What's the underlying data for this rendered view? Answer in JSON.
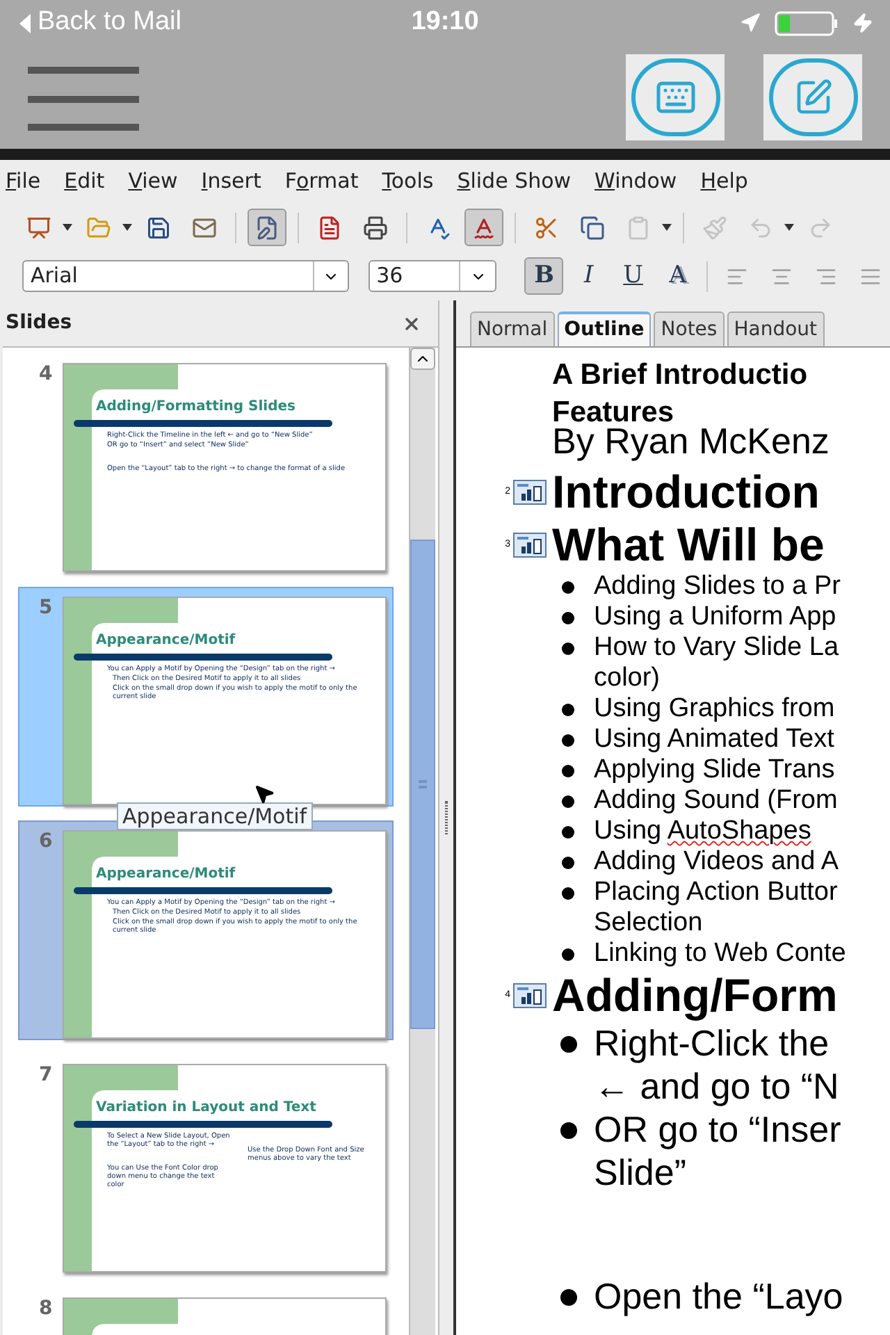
{
  "status_bar": {
    "back_label": "Back to Mail",
    "time": "19:10"
  },
  "menu": [
    {
      "key": "F",
      "after": "ile"
    },
    {
      "key": "E",
      "after": "dit"
    },
    {
      "key": "V",
      "after": "iew"
    },
    {
      "key": "I",
      "after": "nsert"
    },
    {
      "before": "F",
      "key": "o",
      "after": "rmat"
    },
    {
      "key": "T",
      "after": "ools"
    },
    {
      "key": "S",
      "after": "lide Show"
    },
    {
      "key": "W",
      "after": "indow"
    },
    {
      "key": "H",
      "after": "elp"
    }
  ],
  "standard_toolbar": [
    {
      "pressed": false,
      "disabled": false,
      "dropdown": true
    },
    {
      "pressed": false,
      "disabled": false,
      "dropdown": true
    },
    {
      "pressed": false,
      "disabled": false,
      "dropdown": false
    },
    {
      "pressed": false,
      "disabled": false,
      "dropdown": false
    },
    {
      "pressed": true,
      "disabled": false,
      "dropdown": false
    },
    {
      "pressed": false,
      "disabled": false,
      "dropdown": false
    },
    {
      "pressed": false,
      "disabled": false,
      "dropdown": false
    },
    {
      "pressed": false,
      "disabled": false,
      "dropdown": false
    },
    {
      "pressed": true,
      "disabled": false,
      "dropdown": false
    },
    {
      "pressed": false,
      "disabled": false,
      "dropdown": false
    },
    {
      "pressed": false,
      "disabled": false,
      "dropdown": false
    },
    {
      "pressed": false,
      "disabled": true,
      "dropdown": true
    },
    {
      "pressed": false,
      "disabled": true,
      "dropdown": false
    },
    {
      "pressed": false,
      "disabled": true,
      "dropdown": true
    },
    {
      "pressed": false,
      "disabled": true,
      "dropdown": false
    }
  ],
  "format_toolbar": {
    "font_name": "Arial",
    "font_size": "36",
    "style_buttons": [
      {
        "label": "B",
        "pressed": true
      },
      {
        "label": "I",
        "pressed": false
      },
      {
        "label": "U",
        "pressed": false
      },
      {
        "label": "A",
        "pressed": false
      }
    ],
    "align_buttons": [
      {
        "disabled": true
      },
      {
        "disabled": true
      },
      {
        "disabled": true
      },
      {
        "disabled": true
      }
    ]
  },
  "slides_panel": {
    "title": "Slides",
    "tooltip": "Appearance/Motif",
    "slides": [
      {
        "number": "4",
        "title": "Adding/Formatting Slides",
        "selected": false,
        "hovered": false,
        "columns": [
          [
            {
              "kind": "bullet",
              "text": "Right-Click the Timeline in the left ← and go to “New Slide”"
            },
            {
              "kind": "bullet",
              "text": "OR go to “Insert” and select “New Slide”"
            },
            {
              "kind": "gap",
              "text": "Open the “Layout” tab to the right → to change the format of a slide"
            }
          ]
        ]
      },
      {
        "number": "5",
        "title": "Appearance/Motif",
        "selected": true,
        "hovered": false,
        "columns": [
          [
            {
              "kind": "bullet",
              "text": "You can Apply a Motif by Opening the “Design” tab on the right →"
            },
            {
              "kind": "sub",
              "text": "Then Click on the Desired Motif to apply it to all slides"
            },
            {
              "kind": "sub",
              "text": "Click on the small drop down if you wish to apply the motif to only the current slide"
            }
          ]
        ]
      },
      {
        "number": "6",
        "title": "Appearance/Motif",
        "selected": false,
        "hovered": true,
        "columns": [
          [
            {
              "kind": "bullet",
              "text": "You can Apply a Motif by Opening the “Design” tab on the right →"
            },
            {
              "kind": "sub",
              "text": "Then Click on the Desired Motif to apply it to all slides"
            },
            {
              "kind": "sub",
              "text": "Click on the small drop down if you wish to apply the motif to only the current slide"
            }
          ]
        ]
      },
      {
        "number": "7",
        "title": "Variation in Layout and Text",
        "selected": false,
        "hovered": false,
        "columns": [
          [
            {
              "kind": "bullet",
              "text": "To Select a New Slide Layout, Open the “Layout” tab to the right →"
            },
            {
              "kind": "gap",
              "text": "You can Use the Font Color drop down menu to change the text color"
            }
          ],
          [
            {
              "kind": "gap",
              "text": "Use the Drop Down Font and Size menus above to vary the text"
            }
          ]
        ]
      },
      {
        "number": "8",
        "selected": false,
        "hovered": false
      }
    ]
  },
  "view_tabs": [
    {
      "label": "Normal",
      "selected": false
    },
    {
      "label": "Outline",
      "selected": true
    },
    {
      "label": "Notes",
      "selected": false
    },
    {
      "label": "Handout",
      "selected": false
    }
  ],
  "outline": [
    {
      "title_lines": [
        "A Brief Introductio",
        "Features"
      ],
      "items": [
        {
          "kind": "text",
          "lines": [
            "By Ryan McKenz"
          ]
        }
      ]
    },
    {
      "number": "2",
      "title_lines": [
        "Introduction"
      ]
    },
    {
      "number": "3",
      "title_lines": [
        "What Will be"
      ],
      "items": [
        {
          "kind": "bullet",
          "lines": [
            "Adding Slides to a Pr"
          ]
        },
        {
          "kind": "bullet",
          "lines": [
            "Using a Uniform App"
          ]
        },
        {
          "kind": "bullet",
          "lines": [
            "How to Vary Slide La",
            "color)"
          ]
        },
        {
          "kind": "bullet",
          "lines": [
            "Using Graphics from"
          ]
        },
        {
          "kind": "bullet",
          "lines": [
            "Using Animated Text"
          ]
        },
        {
          "kind": "bullet",
          "lines": [
            "Applying Slide Trans"
          ]
        },
        {
          "kind": "bullet",
          "lines": [
            "Adding Sound (From"
          ]
        },
        {
          "kind": "bullet",
          "parts": [
            {
              "text": "Using ",
              "misspelled": false
            },
            {
              "text": "AutoShapes",
              "misspelled": true
            }
          ]
        },
        {
          "kind": "bullet",
          "lines": [
            "Adding Videos and A"
          ]
        },
        {
          "kind": "bullet",
          "lines": [
            "Placing Action Buttor",
            "Selection"
          ]
        },
        {
          "kind": "bullet",
          "lines": [
            "Linking to Web Conte"
          ]
        }
      ]
    },
    {
      "number": "4",
      "title_lines": [
        "Adding/Form"
      ],
      "items": [
        {
          "kind": "bigbullet",
          "lines": [
            "Right-Click the",
            "← and go to “N"
          ]
        },
        {
          "kind": "bigbullet",
          "lines": [
            "OR go to “Inser",
            "Slide”"
          ]
        },
        {
          "kind": "spacedbullet",
          "lines": [
            "Open the “Layo"
          ]
        }
      ]
    }
  ]
}
